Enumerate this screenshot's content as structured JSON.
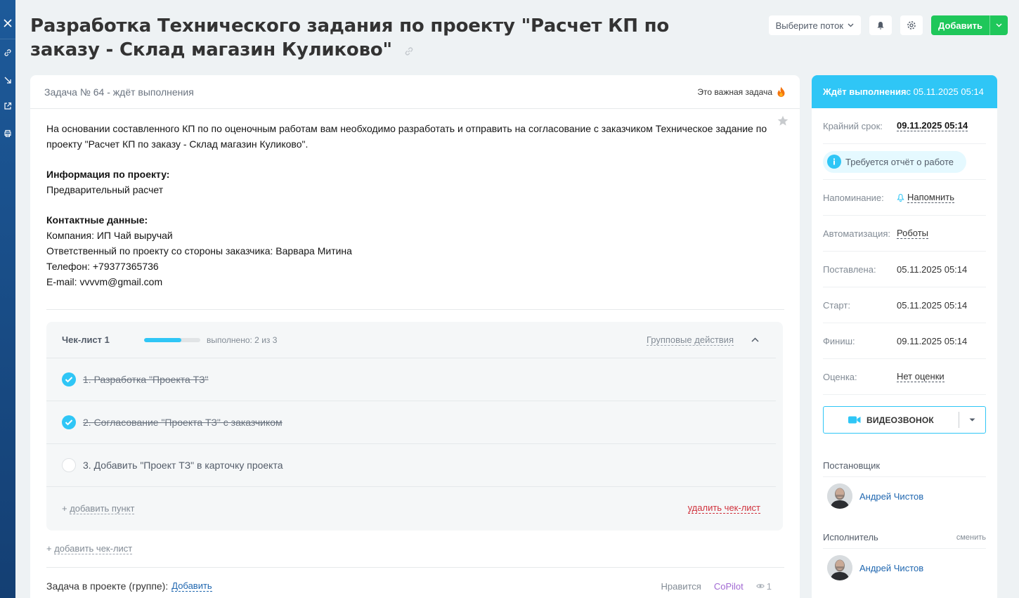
{
  "header": {
    "title": "Разработка Технического задания по проекту \"Расчет КП по заказу - Склад магазин Куликово\"",
    "flow_select": "Выберите поток",
    "add_label": "Добавить"
  },
  "task": {
    "number_status": "Задача № 64 - ждёт выполнения",
    "important_label": "Это важная задача",
    "description": {
      "intro": "На основании составленного КП по по оценочным работам вам необходимо разработать и отправить на согласование с заказчиком Техническое задание по проекту \"Расчет КП по заказу - Склад магазин Куликово\".",
      "project_info_heading": "Информация по проекту:",
      "project_info_text": "Предварительный расчет",
      "contacts_heading": "Контактные данные:",
      "company": "Компания: ИП Чай выручай",
      "responsible": "Ответственный по проекту со стороны заказчика: Варвара Митина",
      "phone": "Телефон: +79377365736",
      "email": "E-mail: vvvvm@gmail.com"
    }
  },
  "checklist": {
    "title": "Чек-лист 1",
    "progress": 0.667,
    "done_text": "выполнено: 2 из 3",
    "group_actions": "Групповые действия",
    "items": [
      {
        "label": "1. Разработка \"Проекта ТЗ\"",
        "done": true
      },
      {
        "label": "2. Согласование \"Проекта ТЗ\" с заказчиком",
        "done": true
      },
      {
        "label": "3. Добавить \"Проект ТЗ\" в карточку проекта",
        "done": false
      }
    ],
    "add_item_prefix": "+ ",
    "add_item": "добавить пункт",
    "delete_checklist": "удалить чек-лист",
    "add_checklist_prefix": "+ ",
    "add_checklist": "добавить чек-лист"
  },
  "project": {
    "label": "Задача в проекте (группе):",
    "add": "Добавить",
    "like": "Нравится",
    "copilot": "CoPilot",
    "views": "1"
  },
  "sidebar": {
    "status_bold": "Ждёт выполнения",
    "status_rest": " с 05.11.2025 05:14",
    "deadline_label": "Крайний срок:",
    "deadline_value": "09.11.2025 05:14",
    "report_required": "Требуется отчёт о работе",
    "reminder_label": "Напоминание:",
    "reminder_value": "Напомнить",
    "automation_label": "Автоматизация:",
    "automation_value": "Роботы",
    "created_label": "Поставлена:",
    "created_value": "05.11.2025 05:14",
    "start_label": "Старт:",
    "start_value": "05.11.2025 05:14",
    "finish_label": "Финиш:",
    "finish_value": "09.11.2025 05:14",
    "rating_label": "Оценка:",
    "rating_value": "Нет оценки",
    "video_call": "ВИДЕОЗВОНОК",
    "creator_label": "Постановщик",
    "creator_name": "Андрей Чистов",
    "assignee_label": "Исполнитель",
    "change": "сменить",
    "assignee_name": "Андрей Чистов"
  },
  "colors": {
    "accent": "#2fc6f6",
    "add_button": "#1fc75a",
    "link": "#2067b0",
    "danger": "#d0323d"
  }
}
